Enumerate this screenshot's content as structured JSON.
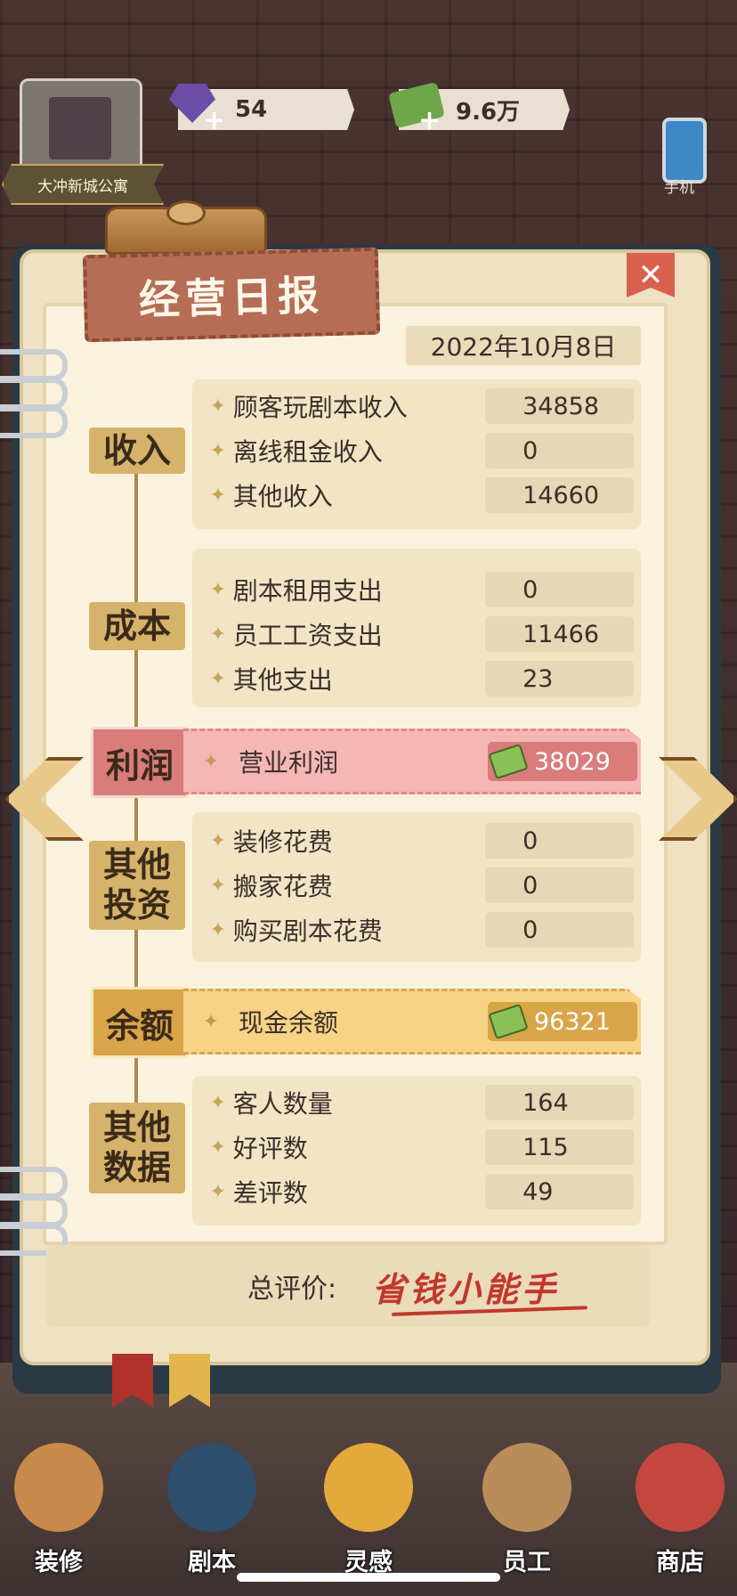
{
  "hud": {
    "location": "大冲新城公寓",
    "gems": "54",
    "cash": "9.6万",
    "phone_label": "手机"
  },
  "report": {
    "title": "经营日报",
    "close": "✕",
    "date": "2022年10月8日",
    "sections": {
      "income": {
        "label": "收入",
        "items": [
          {
            "label": "顾客玩剧本收入",
            "value": "34858"
          },
          {
            "label": "离线租金收入",
            "value": "0"
          },
          {
            "label": "其他收入",
            "value": "14660"
          }
        ]
      },
      "cost": {
        "label": "成本",
        "items": [
          {
            "label": "剧本租用支出",
            "value": "0"
          },
          {
            "label": "员工工资支出",
            "value": "11466"
          },
          {
            "label": "其他支出",
            "value": "23"
          }
        ]
      },
      "profit": {
        "label": "利润",
        "item_label": "营业利润",
        "value": "38029"
      },
      "investment": {
        "label": "其他投资",
        "items": [
          {
            "label": "装修花费",
            "value": "0"
          },
          {
            "label": "搬家花费",
            "value": "0"
          },
          {
            "label": "购买剧本花费",
            "value": "0"
          }
        ]
      },
      "balance": {
        "label": "余额",
        "item_label": "现金余额",
        "value": "96321"
      },
      "other": {
        "label": "其他数据",
        "items": [
          {
            "label": "客人数量",
            "value": "164"
          },
          {
            "label": "好评数",
            "value": "115"
          },
          {
            "label": "差评数",
            "value": "49"
          }
        ]
      }
    },
    "evaluation_label": "总评价:",
    "evaluation_value": "省钱小能手",
    "star_glyph": "✦"
  },
  "bottom_nav": [
    {
      "label": "装修",
      "icon": "house-icon"
    },
    {
      "label": "剧本",
      "icon": "book-icon"
    },
    {
      "label": "灵感",
      "icon": "bulb-icon"
    },
    {
      "label": "员工",
      "icon": "id-card-icon"
    },
    {
      "label": "商店",
      "icon": "shop-icon"
    }
  ],
  "colors": {
    "profit_band": "#f4b7b5",
    "profit_value_bg": "#d97c7a",
    "balance_band": "#f6d385",
    "balance_value_bg": "#d8a548",
    "section_label": "#d6b36a"
  }
}
